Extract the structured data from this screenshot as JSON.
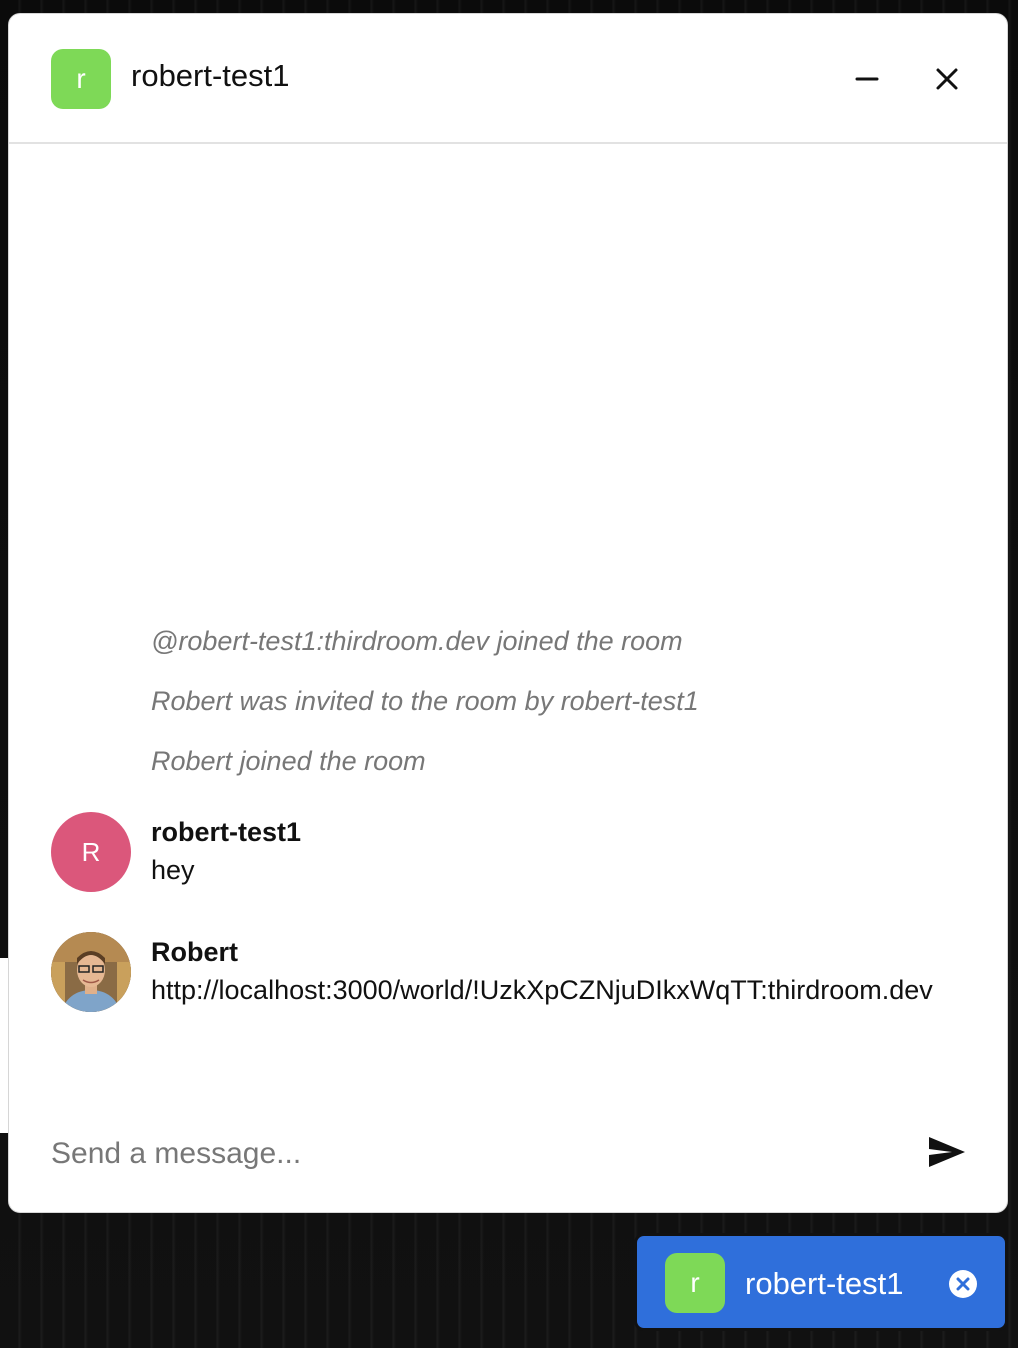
{
  "room": {
    "name": "robert-test1",
    "avatar_letter": "r",
    "avatar_color": "#7ed957"
  },
  "header": {
    "minimize_icon": "minimize-icon",
    "close_icon": "close-icon"
  },
  "timeline": {
    "system_messages": [
      "@robert-test1:thirdroom.dev joined the room",
      "Robert was invited to the room by robert-test1",
      "Robert joined the room"
    ],
    "messages": [
      {
        "sender": "robert-test1",
        "avatar_letter": "R",
        "avatar_color": "#db577b",
        "text": "hey"
      },
      {
        "sender": "Robert",
        "avatar": "profile-photo",
        "text": "http://localhost:3000/world/!UzkXpCZNjuDIkxWqTT:thirdroom.dev"
      }
    ]
  },
  "composer": {
    "placeholder": "Send a message...",
    "value": "",
    "send_icon": "send-icon"
  },
  "minimized_chat": {
    "name": "robert-test1",
    "avatar_letter": "r",
    "background_color": "#2f6fdb",
    "close_icon": "close-circle-icon"
  }
}
